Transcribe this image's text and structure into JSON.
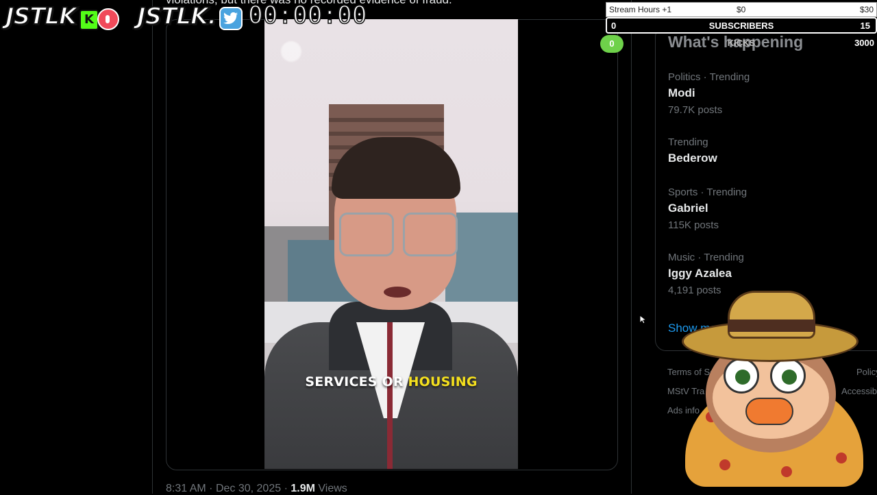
{
  "tweet": {
    "partial_text_top": "violations, but there was no recorded evidence of fraud.",
    "caption_white": "SERVICES OR",
    "caption_highlight": "HOUSING",
    "time": "8:31 AM",
    "sep": "·",
    "date": "Dec 30, 2025",
    "views_count": "1.9M",
    "views_label": "Views"
  },
  "sidebar": {
    "title": "What's happening",
    "trends": [
      {
        "category": "Politics · Trending",
        "name": "Modi",
        "count": "79.7K posts"
      },
      {
        "category": "Trending",
        "name": "Bederow",
        "count": ""
      },
      {
        "category": "Sports · Trending",
        "name": "Gabriel",
        "count": "115K posts"
      },
      {
        "category": "Music · Trending",
        "name": "Iggy Azalea",
        "count": "4,191 posts"
      }
    ],
    "show_more": "Show more",
    "footer": [
      "Terms of Se",
      "Policy",
      "MStV Tra",
      "Accessib",
      "Ads info"
    ]
  },
  "overlay": {
    "logo1": "JSTLK",
    "kick_letter": "K",
    "logo2": "JSTLK.",
    "timer": "00:00:00",
    "stats": {
      "stream_hours": "Stream Hours +1",
      "money_current": "$0",
      "money_goal": "$30",
      "subs_current": "0",
      "subs_label": "SUBSCRIBERS",
      "subs_goal": "15",
      "kicks_current": "0",
      "kicks_label": "KICKS",
      "kicks_goal": "3000"
    }
  },
  "colors": {
    "accent": "#1d9bf0",
    "caption_highlight": "#f5e01e",
    "kick_green": "#53fc18",
    "stats_pill": "#6ed14a"
  }
}
